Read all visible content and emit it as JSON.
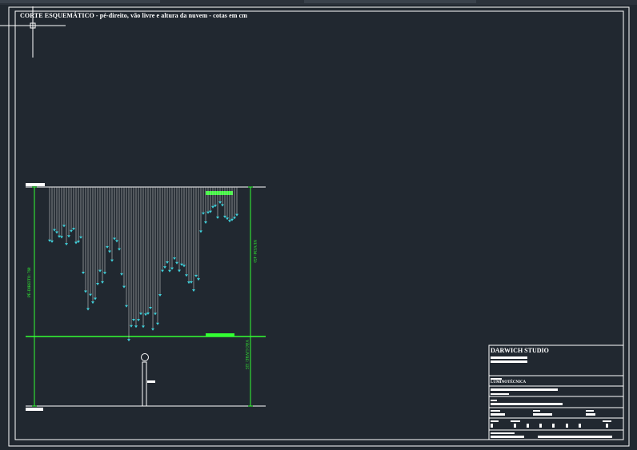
{
  "drawing": {
    "title": "CORTE ESQUEMÁTICO - pé-direito, vão livre e altura da nuvem - cotas em cm",
    "dimensions": {
      "pe_direito": "PÉ-DIREITO: 768",
      "nuvem": "NUVEM: 450",
      "vao_livre": "VÃO LIVRE: 325"
    }
  },
  "title_block": {
    "studio": "DARWICH STUDIO",
    "discipline": "LUMINOTÉCNICA"
  },
  "colors": {
    "background": "#212830",
    "lines": "#ffffff",
    "dimensions": "#33ff33",
    "pendants": "#3fd2dc",
    "cables": "#c8c8c8"
  },
  "icons": [
    "crosshair-cursor-icon",
    "human-figure-icon"
  ]
}
